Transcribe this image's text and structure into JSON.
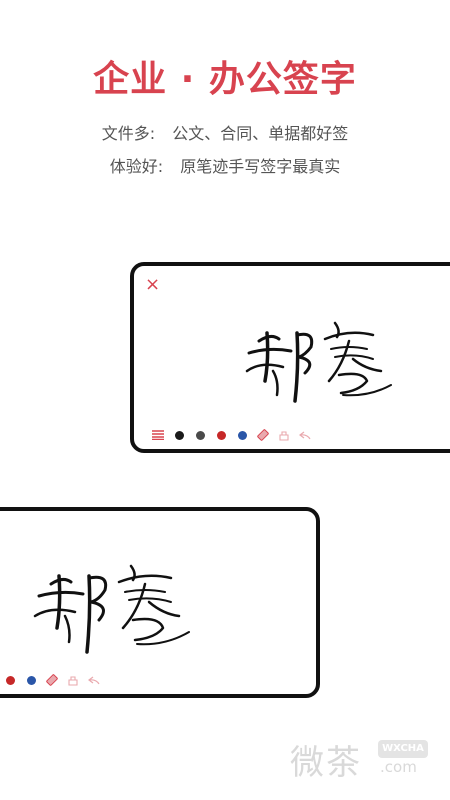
{
  "header": {
    "title": "企业 · 办公签字",
    "line1_label": "文件多:",
    "line1_text": "公文、合同、单据都好签",
    "line2_label": "体验好:",
    "line2_text": "原笔迹手写签字最真实"
  },
  "card_top": {
    "close_label": "×",
    "colors": [
      "#d8434f",
      "#1a1a1a",
      "#4a4a4a",
      "#c62828",
      "#2a56a8"
    ]
  },
  "card_bottom": {
    "colors": [
      "#c62828",
      "#2a56a8"
    ]
  },
  "watermark": {
    "text": "微茶",
    "tag": "WXCHA",
    "domain": ".com"
  },
  "icons": [
    "menu-icon",
    "eraser-icon",
    "clear-icon",
    "undo-icon"
  ]
}
